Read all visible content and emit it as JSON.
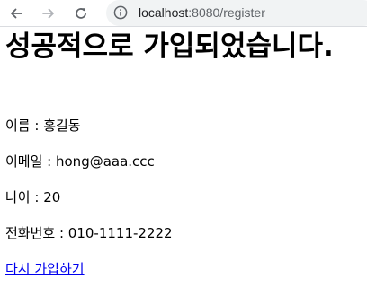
{
  "browser": {
    "url_host": "localhost",
    "url_rest": ":8080/register"
  },
  "page": {
    "heading": "성공적으로 가입되었습니다.",
    "fields": [
      {
        "label": "이름 : ",
        "value": "홍길동"
      },
      {
        "label": "이메일 : ",
        "value": "hong@aaa.ccc"
      },
      {
        "label": "나이 : ",
        "value": "20"
      },
      {
        "label": "전화번호 : ",
        "value": "010-1111-2222"
      }
    ],
    "rejoin_link": "다시 가입하기"
  },
  "colors": {
    "link": "#0000ee",
    "omnibox_bg": "#f1f3f4",
    "icon": "#5f6368"
  },
  "icons": [
    "back-arrow-icon",
    "forward-arrow-icon",
    "reload-icon",
    "info-icon"
  ]
}
